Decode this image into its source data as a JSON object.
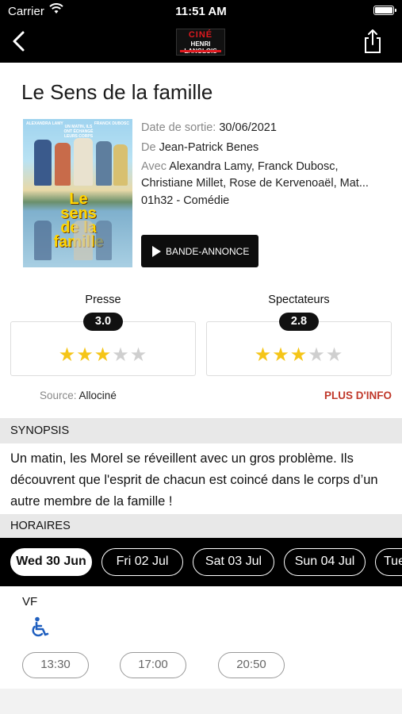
{
  "status_bar": {
    "carrier": "Carrier",
    "time": "11:51 AM"
  },
  "nav": {
    "logo_line1": "CINÉ",
    "logo_line2": "HENRI LANGLOIS"
  },
  "movie": {
    "title": "Le Sens de la famille",
    "poster_headline": "Le sens de la famille",
    "poster_tagline": "UN MATIN, ILS ONT ÉCHANGÉ LEURS CORPS",
    "poster_actor_left": "ALEXANDRA LAMY",
    "poster_actor_right": "FRANCK DUBOSC",
    "release_label": "Date de sortie:",
    "release_date": "30/06/2021",
    "director_label": "De",
    "director": "Jean-Patrick Benes",
    "cast_label": "Avec",
    "cast_line1": "Alexandra Lamy, Franck Dubosc,",
    "cast_line2": "Christiane Millet, Rose de Kervenoaël, Mat...",
    "duration_genre": "01h32 - Comédie",
    "trailer_button": "BANDE-ANNONCE"
  },
  "ratings": {
    "press": {
      "label": "Presse",
      "score": "3.0",
      "stars": 3,
      "max": 5
    },
    "audience": {
      "label": "Spectateurs",
      "score": "2.8",
      "stars": 3,
      "max": 5
    },
    "source_label": "Source:",
    "source": "Allociné",
    "more_info": "PLUS D'INFO",
    "star_color": "#f5c518"
  },
  "synopsis": {
    "header": "SYNOPSIS",
    "text": "Un matin, les Morel se réveillent avec un gros problème. Ils découvrent que l'esprit de chacun est coincé dans le corps d’un autre membre de la famille !"
  },
  "schedule": {
    "header": "HORAIRES",
    "dates": [
      "Wed 30 Jun",
      "Fri 02 Jul",
      "Sat 03 Jul",
      "Sun 04 Jul",
      "Tue"
    ],
    "selected_date": "Wed 30 Jun",
    "version": "VF",
    "accessibility_icon": "wheelchair-icon",
    "times": [
      "13:30",
      "17:00",
      "20:50"
    ]
  },
  "colors": {
    "accent": "#c0392b",
    "bar": "#000000"
  }
}
